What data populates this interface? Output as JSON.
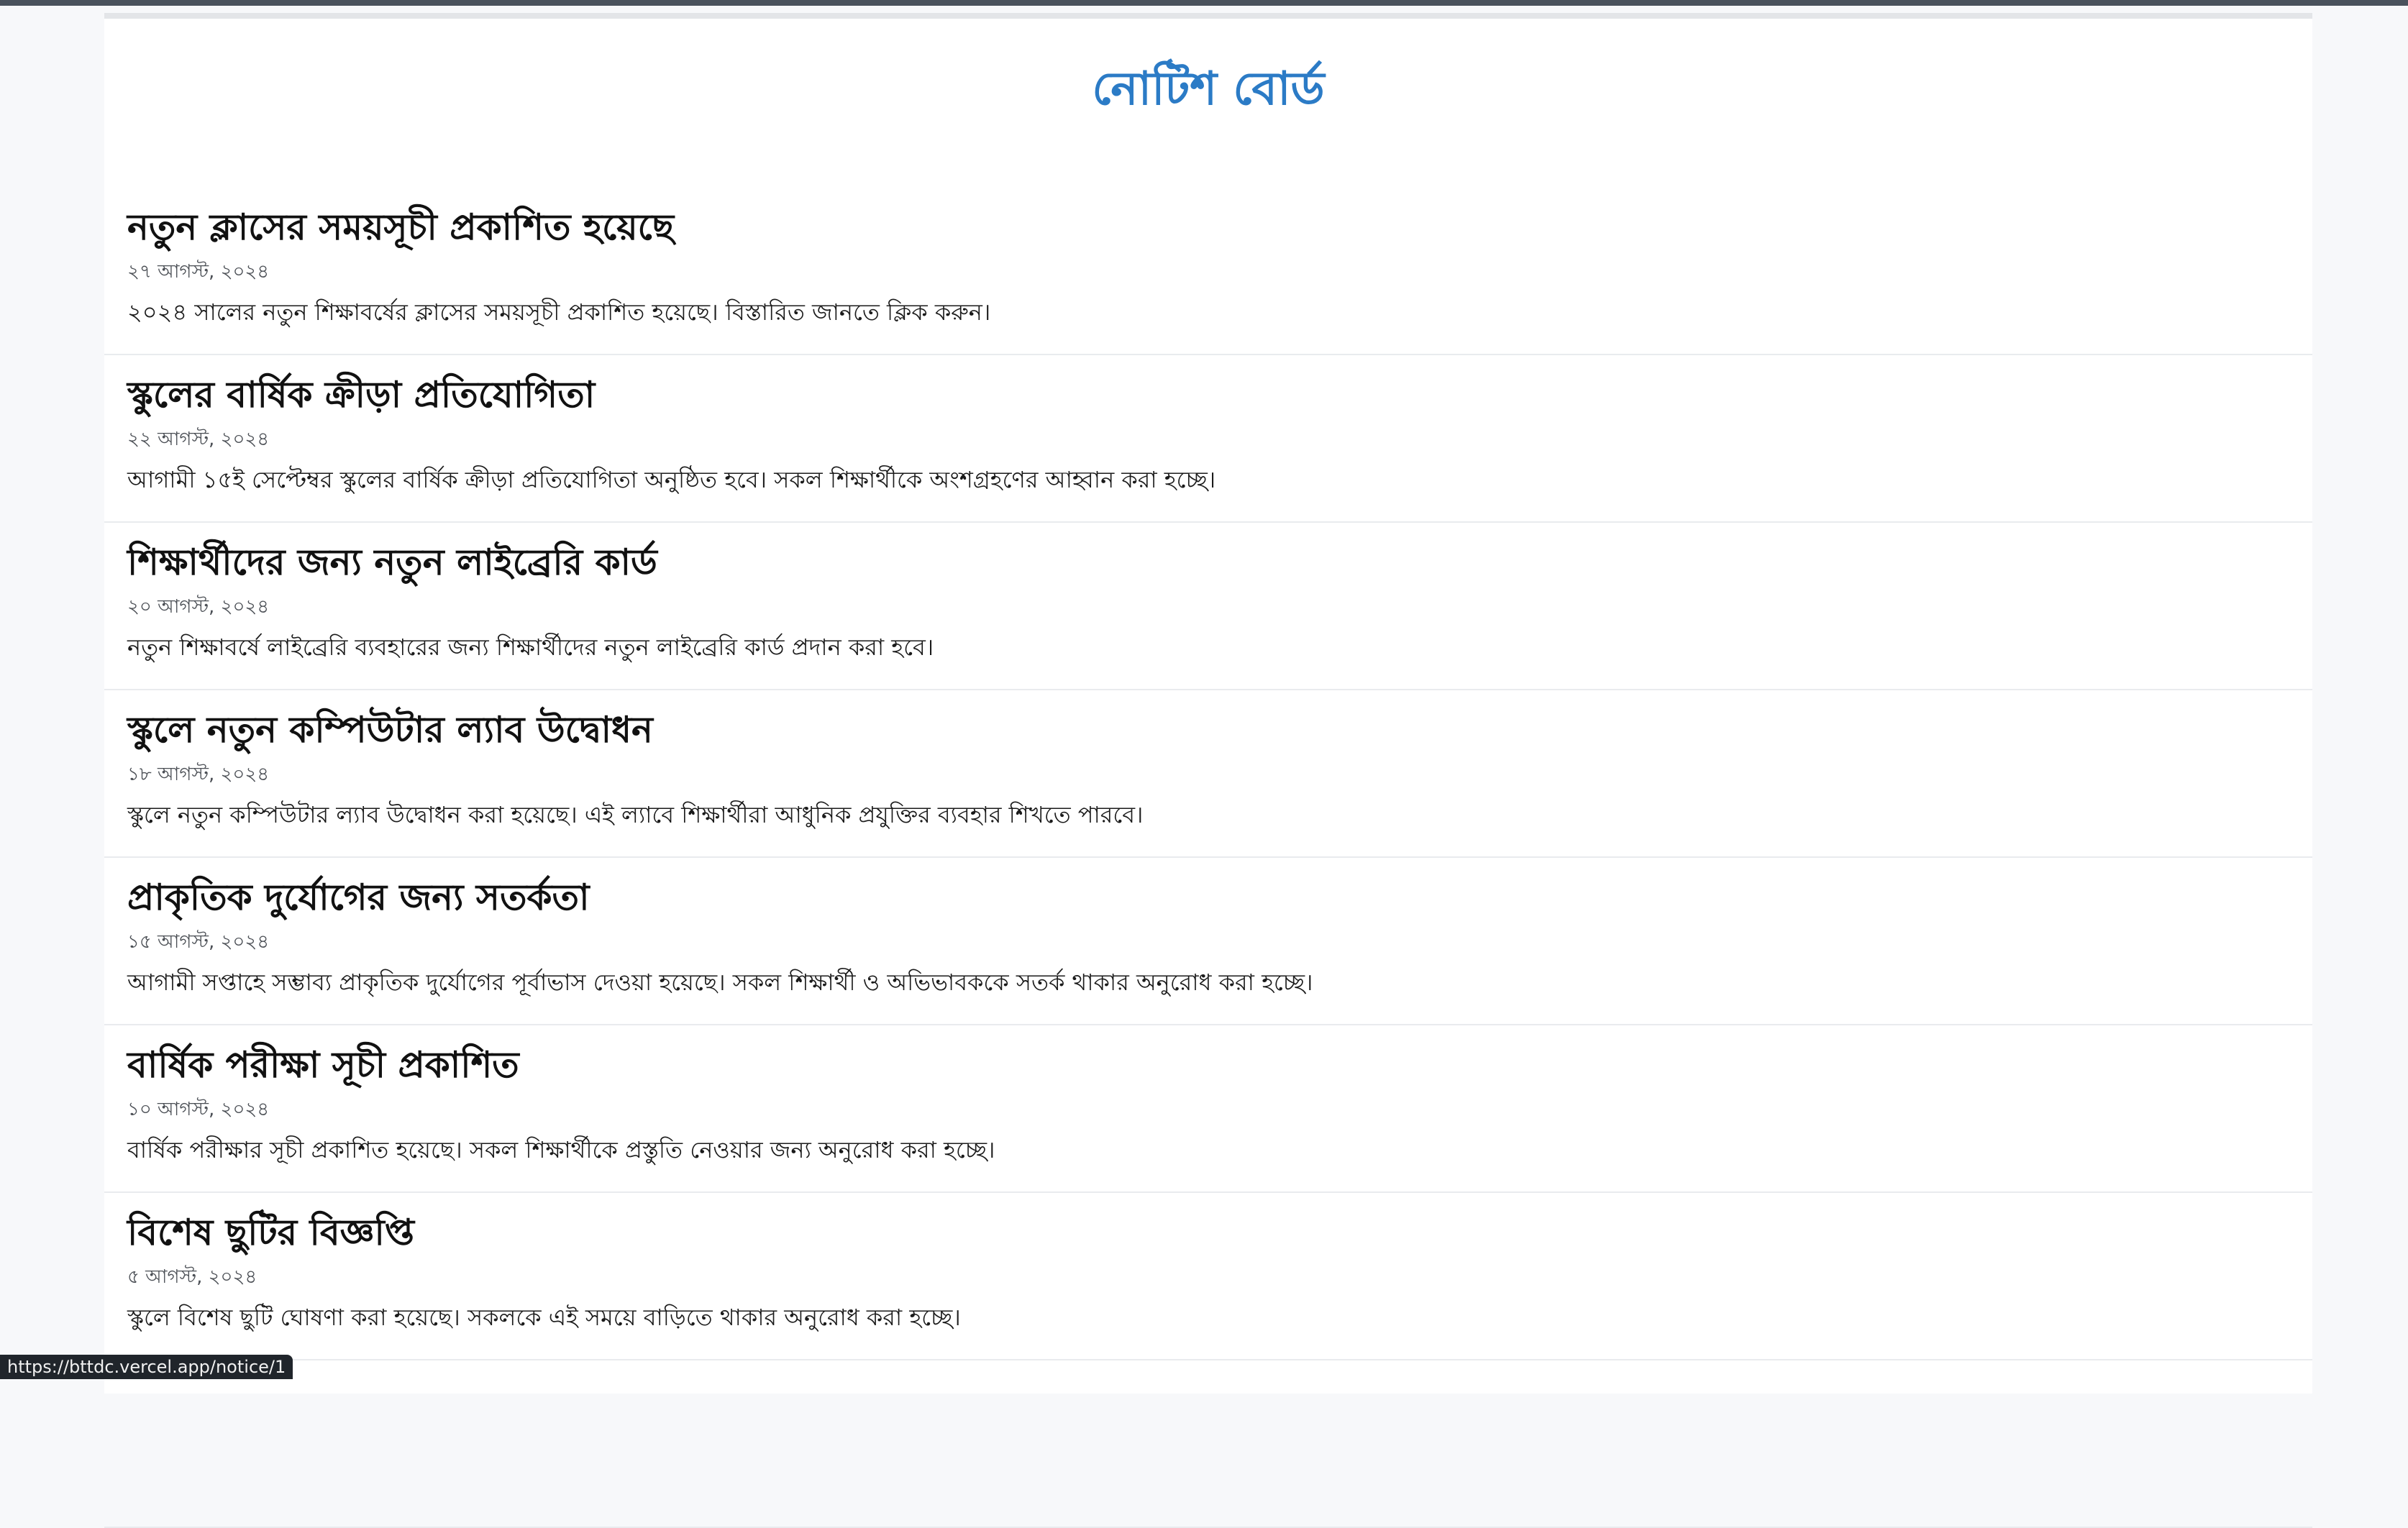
{
  "page": {
    "title": "নোটিশ বোর্ড"
  },
  "notices": [
    {
      "title": "নতুন ক্লাসের সময়সূচী প্রকাশিত হয়েছে",
      "date": "২৭ আগস্ট, ২০২৪",
      "summary": "২০২৪ সালের নতুন শিক্ষাবর্ষের ক্লাসের সময়সূচী প্রকাশিত হয়েছে। বিস্তারিত জানতে ক্লিক করুন।"
    },
    {
      "title": "স্কুলের বার্ষিক ক্রীড়া প্রতিযোগিতা",
      "date": "২২ আগস্ট, ২০২৪",
      "summary": "আগামী ১৫ই সেপ্টেম্বর স্কুলের বার্ষিক ক্রীড়া প্রতিযোগিতা অনুষ্ঠিত হবে। সকল শিক্ষার্থীকে অংশগ্রহণের আহ্বান করা হচ্ছে।"
    },
    {
      "title": "শিক্ষার্থীদের জন্য নতুন লাইব্রেরি কার্ড",
      "date": "২০ আগস্ট, ২০২৪",
      "summary": "নতুন শিক্ষাবর্ষে লাইব্রেরি ব্যবহারের জন্য শিক্ষার্থীদের নতুন লাইব্রেরি কার্ড প্রদান করা হবে।"
    },
    {
      "title": "স্কুলে নতুন কম্পিউটার ল্যাব উদ্বোধন",
      "date": "১৮ আগস্ট, ২০২৪",
      "summary": "স্কুলে নতুন কম্পিউটার ল্যাব উদ্বোধন করা হয়েছে। এই ল্যাবে শিক্ষার্থীরা আধুনিক প্রযুক্তির ব্যবহার শিখতে পারবে।"
    },
    {
      "title": "প্রাকৃতিক দুর্যোগের জন্য সতর্কতা",
      "date": "১৫ আগস্ট, ২০২৪",
      "summary": "আগামী সপ্তাহে সম্ভাব্য প্রাকৃতিক দুর্যোগের পূর্বাভাস দেওয়া হয়েছে। সকল শিক্ষার্থী ও অভিভাবককে সতর্ক থাকার অনুরোধ করা হচ্ছে।"
    },
    {
      "title": "বার্ষিক পরীক্ষা সূচী প্রকাশিত",
      "date": "১০ আগস্ট, ২০২৪",
      "summary": "বার্ষিক পরীক্ষার সূচী প্রকাশিত হয়েছে। সকল শিক্ষার্থীকে প্রস্তুতি নেওয়ার জন্য অনুরোধ করা হচ্ছে।"
    },
    {
      "title": "বিশেষ ছুটির বিজ্ঞপ্তি",
      "date": "৫ আগস্ট, ২০২৪",
      "summary": "স্কুলে বিশেষ ছুটি ঘোষণা করা হয়েছে। সকলকে এই সময়ে বাড়িতে থাকার অনুরোধ করা হচ্ছে।"
    },
    {
      "title": "",
      "date": "",
      "summary": ""
    }
  ],
  "status_bar": {
    "url": "https://bttdc.vercel.app/notice/1"
  }
}
